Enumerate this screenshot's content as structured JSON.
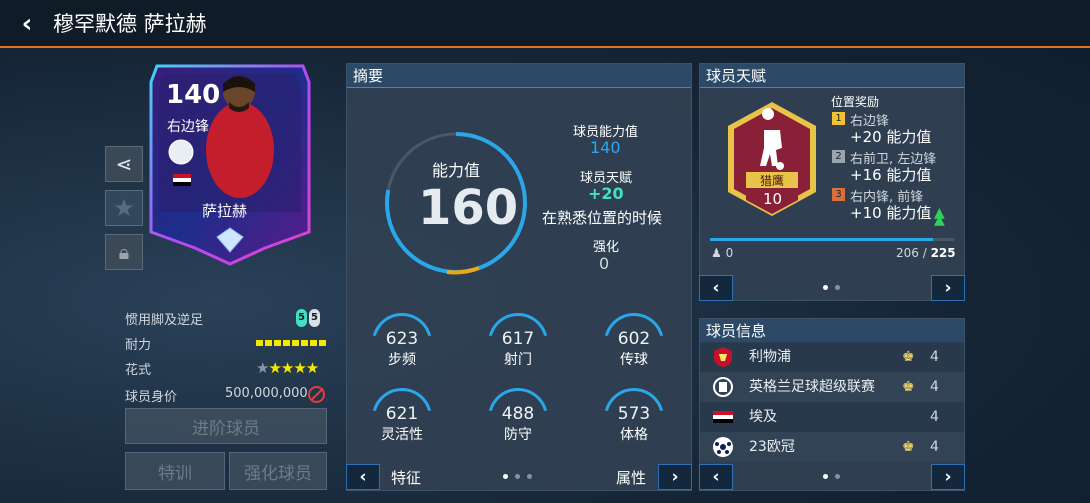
{
  "header": {
    "back_label": "‹",
    "title": "穆罕默德 萨拉赫"
  },
  "card": {
    "rating": "140",
    "position": "右边锋",
    "name": "萨拉赫"
  },
  "side_buttons": {
    "share": "share-icon",
    "favorite": "star-icon",
    "lock": "lock-icon"
  },
  "attributes": [
    {
      "label": "惯用脚及逆足",
      "value": "5 5"
    },
    {
      "label": "耐力",
      "value": "",
      "fill_fraction": 1.0
    },
    {
      "label": "花式",
      "value": "★★★★★",
      "stars": 4,
      "max_stars": 5
    },
    {
      "label": "球员身价",
      "value": "500,000,000"
    }
  ],
  "foot": {
    "strong": "5",
    "weak": "5"
  },
  "actions": {
    "advance": "进阶球员",
    "train": "特训",
    "enhance": "强化球员"
  },
  "summary": {
    "header": "摘要",
    "ovr_label": "能力值",
    "ovr_value": "160",
    "ovr_gauge_fraction": 0.78,
    "player_ovr_label": "球员能力值",
    "player_ovr_value": "140",
    "talent_label": "球员天赋",
    "talent_value": "+20",
    "talent_note": "在熟悉位置的时候",
    "boost_label": "强化",
    "boost_value": "0",
    "stats": [
      {
        "value": "623",
        "label": "步频"
      },
      {
        "value": "617",
        "label": "射门"
      },
      {
        "value": "602",
        "label": "传球"
      },
      {
        "value": "621",
        "label": "灵活性"
      },
      {
        "value": "488",
        "label": "防守"
      },
      {
        "value": "573",
        "label": "体格"
      }
    ],
    "footer_left": "特征",
    "footer_right": "属性"
  },
  "talent": {
    "header": "球员天赋",
    "badge_name": "猎鹰",
    "badge_level": "10",
    "bonus_title": "位置奖励",
    "bonuses": [
      {
        "rank": "1",
        "positions": "右边锋",
        "bonus": "+20 能力值"
      },
      {
        "rank": "2",
        "positions": "右前卫, 左边锋",
        "bonus": "+16 能力值"
      },
      {
        "rank": "3",
        "positions": "右内锋, 前锋",
        "bonus": "+10 能力值"
      }
    ],
    "progress_left": "0",
    "progress_current": "206",
    "progress_sep": " / ",
    "progress_max": "225"
  },
  "info": {
    "header": "球员信息",
    "rows": [
      {
        "icon": "liverpool-crest-icon",
        "text": "利物浦",
        "coach": true,
        "count": "4"
      },
      {
        "icon": "premier-league-icon",
        "text": "英格兰足球超级联赛",
        "coach": true,
        "count": "4"
      },
      {
        "icon": "egypt-flag-icon",
        "text": "埃及",
        "coach": false,
        "count": "4"
      },
      {
        "icon": "ucl-icon",
        "text": "23欧冠",
        "coach": true,
        "count": "4"
      }
    ]
  },
  "colors": {
    "accent": "#e0731f",
    "blue": "#2aa7e8",
    "yellow": "#f4e800",
    "gold": "#e8c34a",
    "maroon": "#8a1f38"
  }
}
